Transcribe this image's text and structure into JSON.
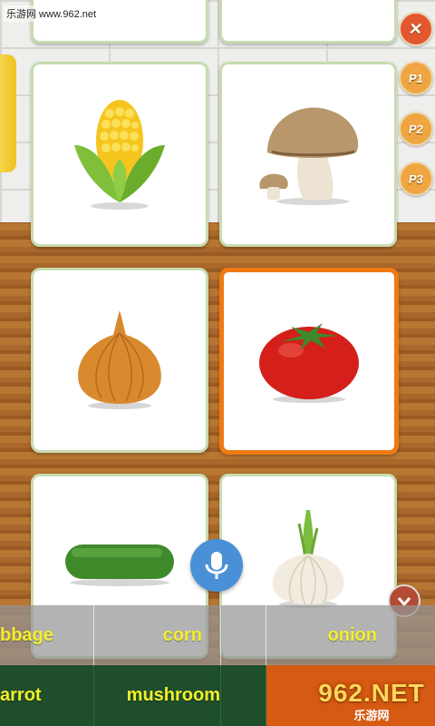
{
  "watermark": "乐游网 www.962.net",
  "sidebar": {
    "close_label": "✕",
    "buttons": [
      "P1",
      "P2",
      "P3"
    ]
  },
  "cards": [
    {
      "name": "corn",
      "selected": false
    },
    {
      "name": "mushroom",
      "selected": false
    },
    {
      "name": "onion",
      "selected": false
    },
    {
      "name": "tomato",
      "selected": true
    },
    {
      "name": "cucumber",
      "selected": false
    },
    {
      "name": "garlic",
      "selected": false
    }
  ],
  "answer_row1": [
    "bbage",
    "corn",
    "onion"
  ],
  "answer_row2": [
    "arrot",
    "mushroom",
    ""
  ],
  "logo": {
    "big": "962.NET",
    "small": "乐游网"
  },
  "colors": {
    "label_text": "#f4ef29",
    "selected_border": "#ef7a14",
    "mic": "#4a90d6",
    "answer_bar": "#1e4e2c"
  }
}
